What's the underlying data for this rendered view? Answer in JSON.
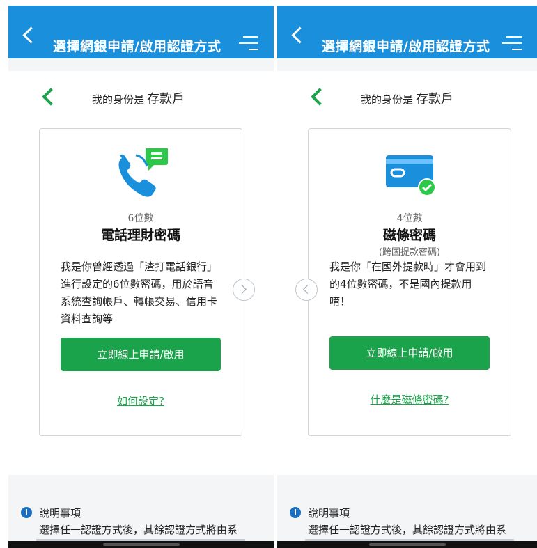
{
  "header": {
    "title": "選擇網銀申請/啟用認證方式"
  },
  "identity": {
    "prefix": "我的身份是",
    "type": "存款戶"
  },
  "cards": [
    {
      "icon": "phone-chat-icon",
      "digits": "6位數",
      "title": "電話理財密碼",
      "subtitle": "",
      "description": "我是你曾經透過「渣打電話銀行」進行設定的6位數密碼，用於語音系統查詢帳戶、轉帳交易、信用卡資料查詢等",
      "button": "立即線上申請/啟用",
      "link": "如何設定?"
    },
    {
      "icon": "card-check-icon",
      "digits": "4位數",
      "title": "磁條密碼",
      "subtitle": "(跨國提款密碼)",
      "description": "我是你「在國外提款時」才會用到的4位數密碼，不是國內提款用唷！",
      "button": "立即線上申請/啟用",
      "link": "什麼是磁條密碼?"
    }
  ],
  "notes": {
    "title": "說明事項",
    "body": "選擇任一認證方式後，其餘認證方式將由系"
  },
  "colors": {
    "header": "#1a8fdb",
    "accent": "#1aa34a"
  }
}
